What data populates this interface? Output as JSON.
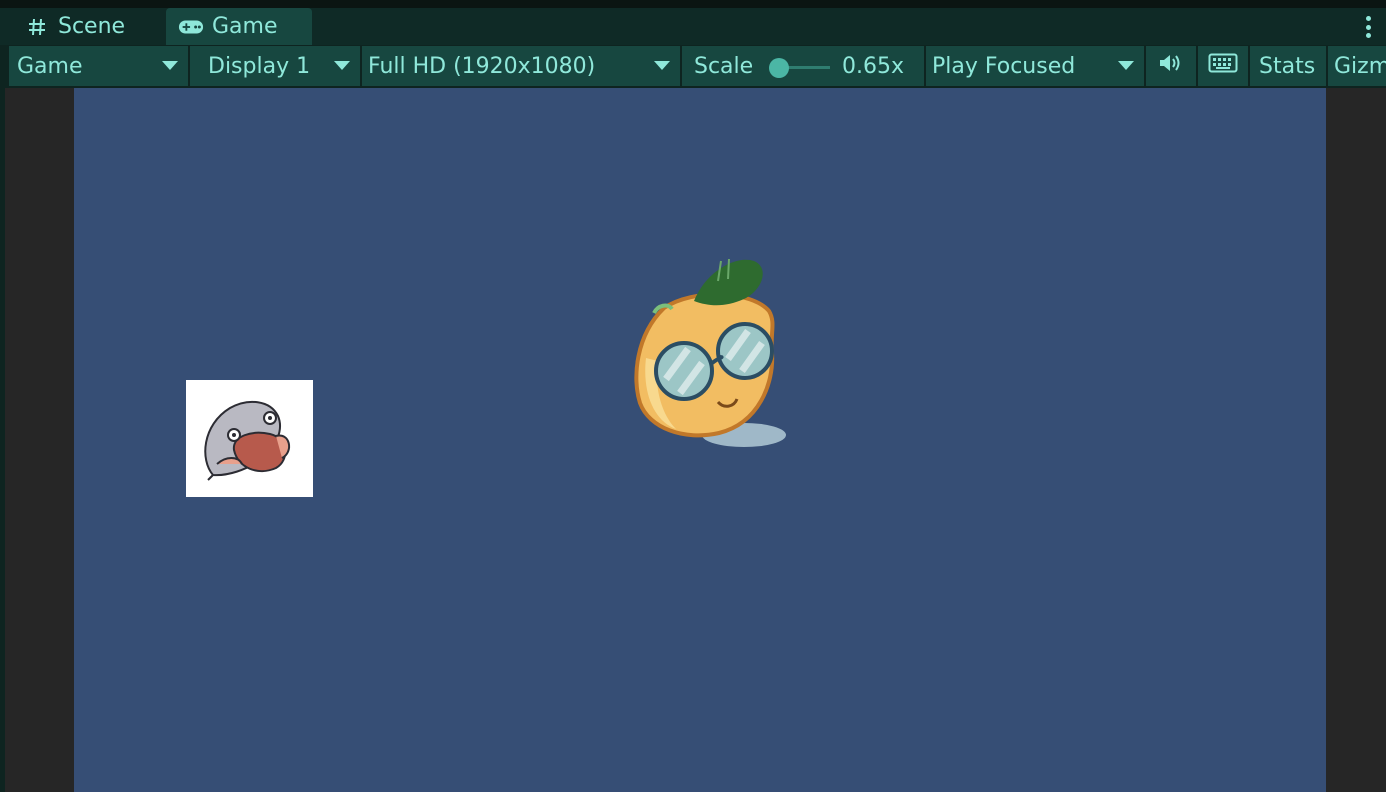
{
  "tabs": [
    {
      "label": "Scene",
      "icon": "hash-icon",
      "active": false
    },
    {
      "label": "Game",
      "icon": "gamepad-icon",
      "active": true
    }
  ],
  "toolbar": {
    "game_dropdown": "Game",
    "display_dropdown": "Display 1",
    "resolution_dropdown": "Full HD (1920x1080)",
    "scale_label": "Scale",
    "scale_value": "0.65x",
    "play_mode_dropdown": "Play Focused",
    "audio_icon": "speaker-icon",
    "keyboard_icon": "keyboard-icon",
    "stats_label": "Stats",
    "gizmos_label": "Gizm"
  },
  "colors": {
    "tab_active": "#174740",
    "tab_bar": "#0f2a26",
    "accent_text": "#8fe8da",
    "viewport_bg": "#364e75",
    "outer_bg": "#262626"
  },
  "scene_objects": [
    {
      "name": "lemon-character-sprite"
    },
    {
      "name": "mussel-sprite"
    }
  ]
}
